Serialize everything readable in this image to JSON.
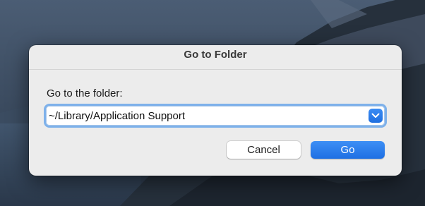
{
  "dialog": {
    "title": "Go to Folder",
    "prompt": "Go to the folder:",
    "path_value": "~/Library/Application Support",
    "buttons": {
      "cancel": "Cancel",
      "go": "Go"
    }
  },
  "icons": {
    "history_dropdown": "chevron-down-icon"
  },
  "colors": {
    "accent": "#1f6fe0",
    "focus_ring": "#7eb1ea",
    "dialog_background": "#ececec"
  }
}
